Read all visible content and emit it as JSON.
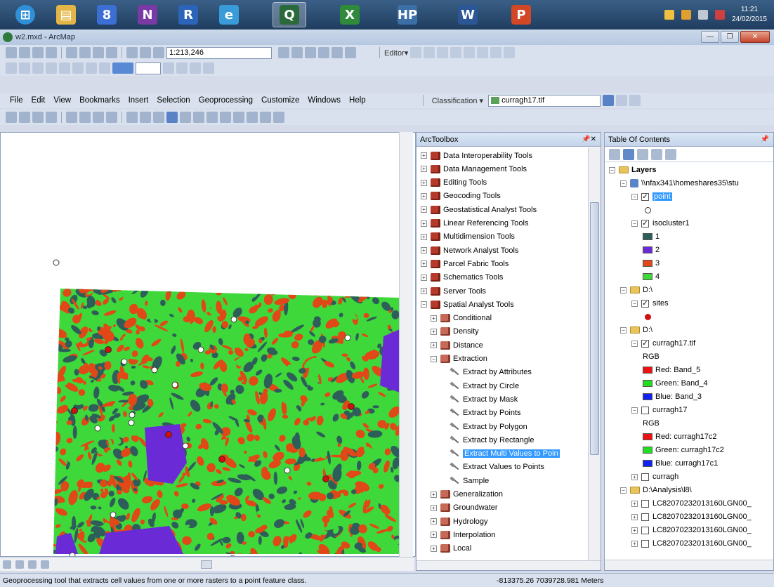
{
  "taskbar": {
    "apps": [
      {
        "name": "start-orb",
        "color": "#2f8fd9",
        "glyph": "⊞"
      },
      {
        "name": "file-explorer",
        "color": "#e3b646",
        "glyph": "▤"
      },
      {
        "name": "google-earth",
        "color": "#3b6fd4",
        "glyph": "8"
      },
      {
        "name": "onenote",
        "color": "#7a3aa6",
        "glyph": "N"
      },
      {
        "name": "r-language",
        "color": "#2b64b8",
        "glyph": "R"
      },
      {
        "name": "internet-explorer",
        "color": "#3a9bd9",
        "glyph": "e"
      },
      {
        "name": "arcmap",
        "color": "#2a6a3a",
        "glyph": "Q"
      },
      {
        "name": "excel",
        "color": "#2f8a3c",
        "glyph": "X"
      },
      {
        "name": "hp-app",
        "color": "#3b6fa6",
        "glyph": "HP"
      },
      {
        "name": "word",
        "color": "#2b5797",
        "glyph": "W"
      },
      {
        "name": "powerpoint",
        "color": "#d24726",
        "glyph": "P"
      }
    ],
    "clock_time": "11:21",
    "clock_date": "24/02/2015"
  },
  "window": {
    "title": "w2.mxd - ArcMap"
  },
  "toolbar1": {
    "scale": "1:213,246",
    "editor_label": "Editor▾"
  },
  "menu": {
    "items": [
      "File",
      "Edit",
      "View",
      "Bookmarks",
      "Insert",
      "Selection",
      "Geoprocessing",
      "Customize",
      "Windows",
      "Help"
    ],
    "classification_label": "Classification ▾",
    "classification_layer": "curragh17.tif"
  },
  "arctoolbox": {
    "title": "ArcToolbox",
    "items": [
      {
        "label": "Data Interoperability Tools",
        "level": 0,
        "kind": "toolbox",
        "exp": "+"
      },
      {
        "label": "Data Management Tools",
        "level": 0,
        "kind": "toolbox",
        "exp": "+"
      },
      {
        "label": "Editing Tools",
        "level": 0,
        "kind": "toolbox",
        "exp": "+"
      },
      {
        "label": "Geocoding Tools",
        "level": 0,
        "kind": "toolbox",
        "exp": "+"
      },
      {
        "label": "Geostatistical Analyst Tools",
        "level": 0,
        "kind": "toolbox",
        "exp": "+"
      },
      {
        "label": "Linear Referencing Tools",
        "level": 0,
        "kind": "toolbox",
        "exp": "+"
      },
      {
        "label": "Multidimension Tools",
        "level": 0,
        "kind": "toolbox",
        "exp": "+"
      },
      {
        "label": "Network Analyst Tools",
        "level": 0,
        "kind": "toolbox",
        "exp": "+"
      },
      {
        "label": "Parcel Fabric Tools",
        "level": 0,
        "kind": "toolbox",
        "exp": "+"
      },
      {
        "label": "Schematics Tools",
        "level": 0,
        "kind": "toolbox",
        "exp": "+"
      },
      {
        "label": "Server Tools",
        "level": 0,
        "kind": "toolbox",
        "exp": "+"
      },
      {
        "label": "Spatial Analyst Tools",
        "level": 0,
        "kind": "toolbox",
        "exp": "−"
      },
      {
        "label": "Conditional",
        "level": 1,
        "kind": "toolset",
        "exp": "+"
      },
      {
        "label": "Density",
        "level": 1,
        "kind": "toolset",
        "exp": "+"
      },
      {
        "label": "Distance",
        "level": 1,
        "kind": "toolset",
        "exp": "+"
      },
      {
        "label": "Extraction",
        "level": 1,
        "kind": "toolset",
        "exp": "−"
      },
      {
        "label": "Extract by Attributes",
        "level": 2,
        "kind": "tool",
        "exp": ""
      },
      {
        "label": "Extract by Circle",
        "level": 2,
        "kind": "tool",
        "exp": ""
      },
      {
        "label": "Extract by Mask",
        "level": 2,
        "kind": "tool",
        "exp": ""
      },
      {
        "label": "Extract by Points",
        "level": 2,
        "kind": "tool",
        "exp": ""
      },
      {
        "label": "Extract by Polygon",
        "level": 2,
        "kind": "tool",
        "exp": ""
      },
      {
        "label": "Extract by Rectangle",
        "level": 2,
        "kind": "tool",
        "exp": ""
      },
      {
        "label": "Extract Multi Values to Poin",
        "level": 2,
        "kind": "tool",
        "exp": "",
        "selected": true
      },
      {
        "label": "Extract Values to Points",
        "level": 2,
        "kind": "tool",
        "exp": ""
      },
      {
        "label": "Sample",
        "level": 2,
        "kind": "tool",
        "exp": ""
      },
      {
        "label": "Generalization",
        "level": 1,
        "kind": "toolset",
        "exp": "+"
      },
      {
        "label": "Groundwater",
        "level": 1,
        "kind": "toolset",
        "exp": "+"
      },
      {
        "label": "Hydrology",
        "level": 1,
        "kind": "toolset",
        "exp": "+"
      },
      {
        "label": "Interpolation",
        "level": 1,
        "kind": "toolset",
        "exp": "+"
      },
      {
        "label": "Local",
        "level": 1,
        "kind": "toolset",
        "exp": "+"
      }
    ]
  },
  "toc": {
    "title": "Table Of Contents",
    "items": [
      {
        "label": "Layers",
        "level": 0,
        "kind": "layers",
        "exp": "−",
        "bold": true
      },
      {
        "label": "\\\\nfax341\\homeshares35\\stu",
        "level": 1,
        "kind": "db",
        "exp": "−"
      },
      {
        "label": "point",
        "level": 2,
        "kind": "check",
        "checked": true,
        "exp": "−",
        "selected": true
      },
      {
        "label": "",
        "level": 3,
        "kind": "symbol",
        "symbol": "hollow-circle"
      },
      {
        "label": "isocluster1",
        "level": 2,
        "kind": "check",
        "checked": true,
        "exp": "−"
      },
      {
        "label": "1",
        "level": 3,
        "kind": "swatch",
        "color": "#2e5e59"
      },
      {
        "label": "2",
        "level": 3,
        "kind": "swatch",
        "color": "#6a2bd6"
      },
      {
        "label": "3",
        "level": 3,
        "kind": "swatch",
        "color": "#e04818"
      },
      {
        "label": "4",
        "level": 3,
        "kind": "swatch",
        "color": "#3fd83a"
      },
      {
        "label": "D:\\",
        "level": 1,
        "kind": "folder",
        "exp": "−"
      },
      {
        "label": "sites",
        "level": 2,
        "kind": "check",
        "checked": true,
        "exp": "−"
      },
      {
        "label": "",
        "level": 3,
        "kind": "symbol",
        "symbol": "red-dot"
      },
      {
        "label": "D:\\",
        "level": 1,
        "kind": "folder",
        "exp": "−"
      },
      {
        "label": "curragh17.tif",
        "level": 2,
        "kind": "check",
        "checked": true,
        "exp": "−"
      },
      {
        "label": "RGB",
        "level": 3,
        "kind": "text"
      },
      {
        "label": "Red:   Band_5",
        "level": 3,
        "kind": "swatch",
        "color": "#ee1111"
      },
      {
        "label": "Green: Band_4",
        "level": 3,
        "kind": "swatch",
        "color": "#22dd22"
      },
      {
        "label": "Blue:   Band_3",
        "level": 3,
        "kind": "swatch",
        "color": "#1122ee"
      },
      {
        "label": "curragh17",
        "level": 2,
        "kind": "check",
        "checked": false,
        "exp": "−"
      },
      {
        "label": "RGB",
        "level": 3,
        "kind": "text"
      },
      {
        "label": "Red:   curragh17c2",
        "level": 3,
        "kind": "swatch",
        "color": "#ee1111"
      },
      {
        "label": "Green: curragh17c2",
        "level": 3,
        "kind": "swatch",
        "color": "#22dd22"
      },
      {
        "label": "Blue:   curragh17c1",
        "level": 3,
        "kind": "swatch",
        "color": "#1122ee"
      },
      {
        "label": "curragh",
        "level": 2,
        "kind": "check",
        "checked": false,
        "exp": "+"
      },
      {
        "label": "D:\\Analysis\\l8\\",
        "level": 1,
        "kind": "folder",
        "exp": "−"
      },
      {
        "label": "LC82070232013160LGN00_",
        "level": 2,
        "kind": "check",
        "checked": false,
        "exp": "+"
      },
      {
        "label": "LC82070232013160LGN00_",
        "level": 2,
        "kind": "check",
        "checked": false,
        "exp": "+"
      },
      {
        "label": "LC82070232013160LGN00_",
        "level": 2,
        "kind": "check",
        "checked": false,
        "exp": "+"
      },
      {
        "label": "LC82070232013160LGN00_",
        "level": 2,
        "kind": "check",
        "checked": false,
        "exp": "+"
      }
    ]
  },
  "status": {
    "message": "Geoprocessing tool that extracts cell values from one or more rasters to a point feature class.",
    "coords": "-813375.26  7039728.981 Meters"
  },
  "map": {
    "class_colors": [
      "#3fd83a",
      "#e04818",
      "#2e5e59",
      "#6a2bd6"
    ]
  }
}
